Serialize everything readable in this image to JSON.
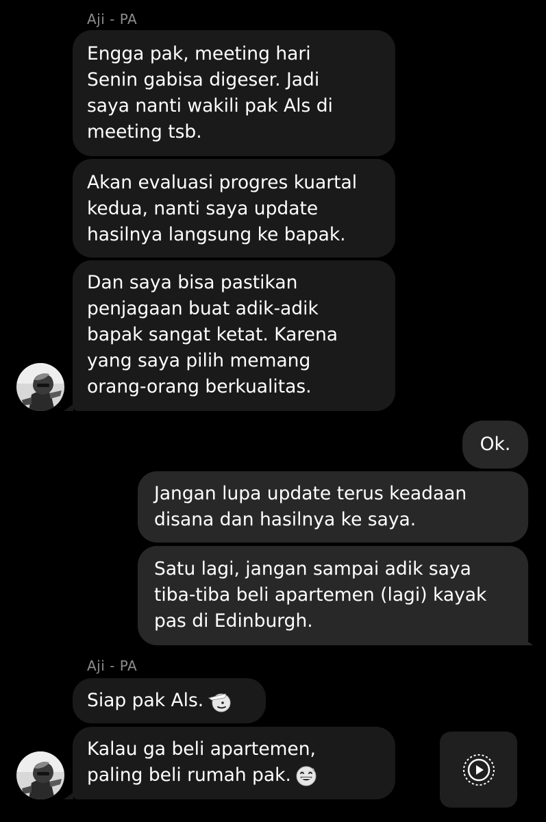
{
  "chat": {
    "group_one": {
      "sender_name": "Aji - PA",
      "messages": [
        "Engga pak, meeting hari\nSenin gabisa digeser. Jadi\nsaya nanti wakili pak Als di\nmeeting tsb.",
        "Akan evaluasi progres kuartal\nkedua, nanti saya update\nhasilnya langsung ke bapak.",
        "Dan saya bisa pastikan\npenjagaan buat adik-adik\nbapak sangat ketat. Karena\nyang saya pilih memang\norang-orang berkualitas."
      ]
    },
    "own_messages": [
      "Ok.",
      "Jangan lupa update terus keadaan\ndisana dan hasilnya ke saya.",
      "Satu lagi, jangan sampai adik saya\ntiba-tiba beli apartemen (lagi) kayak\npas di Edinburgh."
    ],
    "group_two": {
      "sender_name": "Aji - PA",
      "messages": [
        "Siap pak Als.",
        "Kalau ga beli apartemen,\npaling beli rumah pak."
      ],
      "message_icons": [
        "saluting-face-icon",
        "grinning-sweat-face-icon"
      ]
    },
    "floating_button_icon": "play-circle-icon"
  },
  "colors": {
    "background": "#000000",
    "incoming_bubble": "#1a1a1a",
    "outgoing_bubble": "#282828",
    "sender_name": "#8e8e8e",
    "text": "#ffffff"
  }
}
